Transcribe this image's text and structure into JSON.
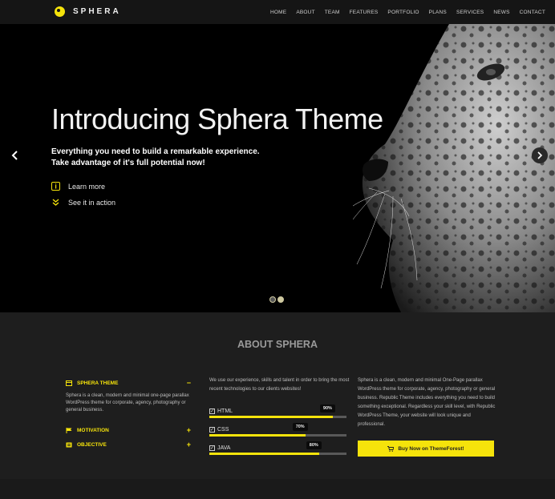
{
  "brand": {
    "name": "SPHERA",
    "accent": "#f5e30b"
  },
  "nav": {
    "items": [
      "HOME",
      "ABOUT",
      "TEAM",
      "FEATURES",
      "PORTFOLIO",
      "PLANS",
      "SERVICES",
      "NEWS",
      "CONTACT"
    ]
  },
  "hero": {
    "title": "Introducing Sphera Theme",
    "subtitle_line1": "Everything you need to build a remarkable experience.",
    "subtitle_line2": "Take advantage of it's full potential now!",
    "learn_more": "Learn more",
    "see_action": "See it in action",
    "slides": 2,
    "active_slide": 1
  },
  "about": {
    "title": "ABOUT SPHERA",
    "accordion": [
      {
        "label": "SPHERA THEME",
        "sign": "−",
        "icon": "credit-card-icon",
        "body": "Sphera is a clean, modern and minimal one-page parallax WordPress theme for corporate, agency, photography or general business."
      },
      {
        "label": "MOTIVATION",
        "sign": "+",
        "icon": "flag-icon"
      },
      {
        "label": "OBJECTIVE",
        "sign": "+",
        "icon": "bookmark-icon"
      }
    ],
    "col2_text": "We use our experience, skills and talent in order to bring the most recent technologies to our clients websites!",
    "skills": [
      {
        "name": "HTML",
        "percent": 90,
        "label": "90%"
      },
      {
        "name": "CSS",
        "percent": 70,
        "label": "70%"
      },
      {
        "name": "JAVA",
        "percent": 80,
        "label": "80%"
      }
    ],
    "col3_text": "Sphera is a clean, modern and minimal One-Page parallax WordPress theme for corporate, agency, photography or general business. Republic Theme includes everything you need to build something exceptional. Regardless your skill level, with Republic WordPress Theme, your website will look unique and professional.",
    "buy_label": "Buy Now on ThemeForest!"
  }
}
